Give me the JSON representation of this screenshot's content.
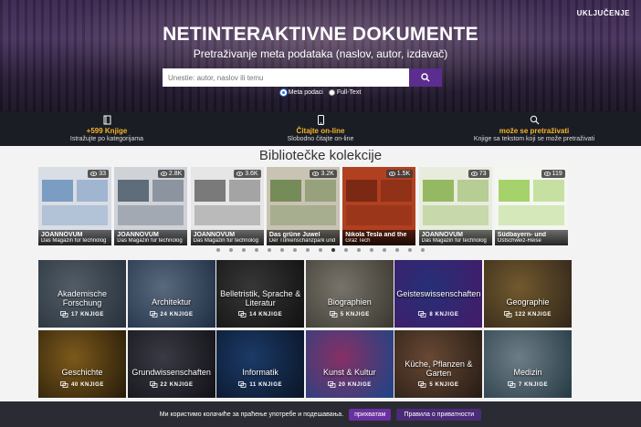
{
  "header": {
    "login_label": "UKLJUČENJE",
    "title": "NETINTERAKTIVNE DOKUMENTE",
    "subtitle": "Pretraživanje meta podataka (naslov, autor, izdavač)",
    "search_placeholder": "Unestie: autor, naslov ili temu",
    "radio_meta": "Meta podaci",
    "radio_fulltext": "Full-Text"
  },
  "features": [
    {
      "icon": "book-icon",
      "title": "+599 Knjige",
      "subtitle": "Istražujte po kategorijama"
    },
    {
      "icon": "tablet-icon",
      "title": "Čitajte on-line",
      "subtitle": "Slobodno čitajte on-line"
    },
    {
      "icon": "search-icon",
      "title": "može se pretraživati",
      "subtitle": "Knjige sa tekstom koji se može pretraživati"
    }
  ],
  "collections_title": "Bibliotečke kolekcije",
  "collections": [
    {
      "views": "33",
      "title": "JOANNOVUM",
      "subtitle": "Das Magazin für technolog",
      "color": "#d9dde4",
      "accent": "#5b86b8"
    },
    {
      "views": "2.8K",
      "title": "JOANNOVUM",
      "subtitle": "Das Magazin für technolog",
      "color": "#cfd3d8",
      "accent": "#3a4a5a"
    },
    {
      "views": "3.6K",
      "title": "JOANNOVUM",
      "subtitle": "Das Magazin für technolog",
      "color": "#e6e6e6",
      "accent": "#555"
    },
    {
      "views": "3.2K",
      "title": "Das grüne Juwel",
      "subtitle": "Der Türkenschanzpark und",
      "color": "#c9c3b3",
      "accent": "#5a7a3a"
    },
    {
      "views": "1.5K",
      "title": "Nikola Tesla and the",
      "subtitle": "Graz Tech",
      "color": "#b04020",
      "accent": "#6a2010"
    },
    {
      "views": "73",
      "title": "JOANNOVUM",
      "subtitle": "Das Magazin für technolog",
      "color": "#e8ecdc",
      "accent": "#7aa83a"
    },
    {
      "views": "119",
      "title": "Südbayern- und",
      "subtitle": "Ostschweiz-Reise",
      "color": "#f4f6f0",
      "accent": "#8cc63f"
    }
  ],
  "carousel_dots": 17,
  "carousel_active": 9,
  "categories": [
    {
      "name": "Akademische Forschung",
      "count": "17 KNJIGE",
      "c1": "#7f8fa0",
      "c2": "#3c4a5a"
    },
    {
      "name": "Architektur",
      "count": "24 KNJIGE",
      "c1": "#8aa2c0",
      "c2": "#2e4668"
    },
    {
      "name": "Belletristik, Sprache & Literatur",
      "count": "14 KNJIGE",
      "c1": "#555",
      "c2": "#1a1a1a"
    },
    {
      "name": "Biographien",
      "count": "5 KNJIGE",
      "c1": "#b8b2a4",
      "c2": "#5a554a"
    },
    {
      "name": "Geisteswissenschaften",
      "count": "8 KNJIGE",
      "c1": "#3a4ab8",
      "c2": "#6a2aa0"
    },
    {
      "name": "Geographie",
      "count": "122 KNJIGE",
      "c1": "#b08a48",
      "c2": "#4a3a28"
    },
    {
      "name": "Geschichte",
      "count": "40 KNJIGE",
      "c1": "#c08a2a",
      "c2": "#3a2a10"
    },
    {
      "name": "Grundwissenschaften",
      "count": "22 KNJIGE",
      "c1": "#5a5a6a",
      "c2": "#1a1a22"
    },
    {
      "name": "Informatik",
      "count": "11 KNJIGE",
      "c1": "#2a5aa0",
      "c2": "#10203a"
    },
    {
      "name": "Kunst & Kultur",
      "count": "20 KNJIGE",
      "c1": "#d04a9a",
      "c2": "#2a6ad0"
    },
    {
      "name": "Küche, Pflanzen & Garten",
      "count": "5 KNJIGE",
      "c1": "#a07050",
      "c2": "#3a2a20"
    },
    {
      "name": "Medizin",
      "count": "7 KNJIGE",
      "c1": "#a8c0d0",
      "c2": "#3a5a6a"
    }
  ],
  "cookie": {
    "text": "Ми користимо колачиће за праћење употребе и подешавања.",
    "accept": "прихватам",
    "policy": "Правила о приватности"
  },
  "colors": {
    "accent": "#5b2d8e",
    "feature_title": "#f5b32a",
    "dark_band": "#1a1d24"
  }
}
